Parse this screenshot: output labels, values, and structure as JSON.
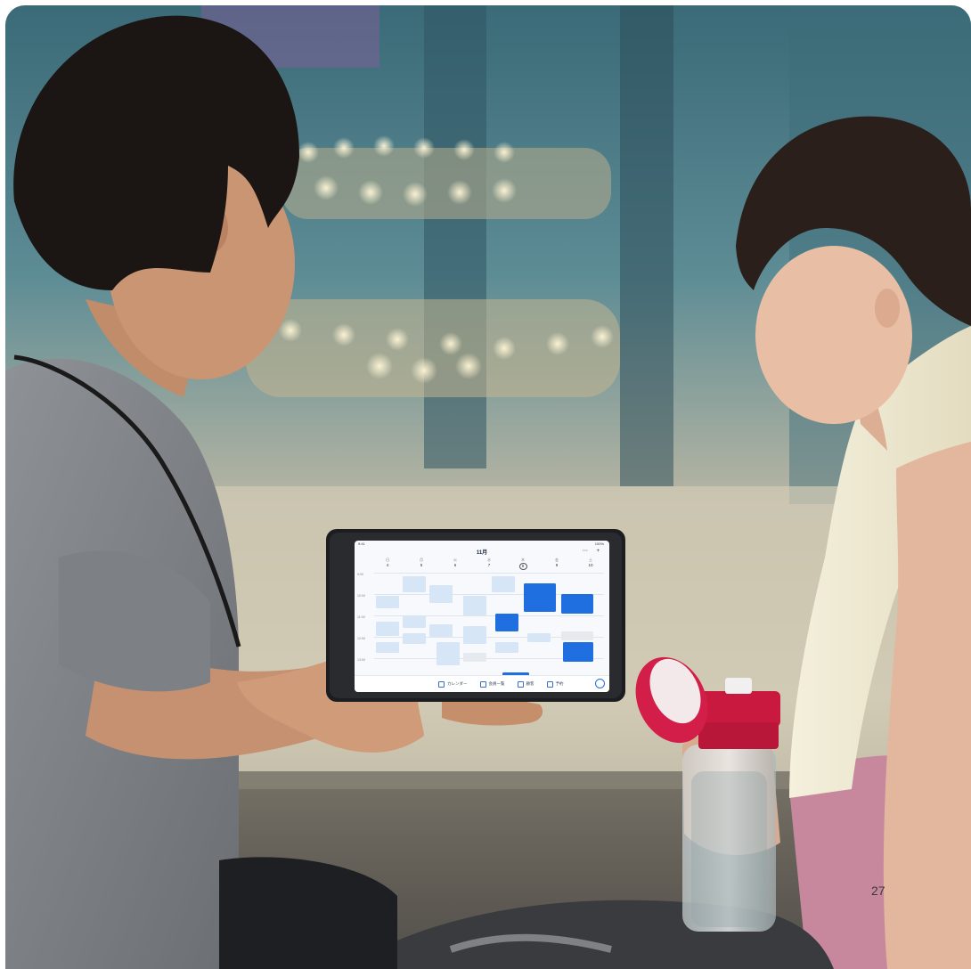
{
  "page": {
    "number": "27"
  },
  "tablet": {
    "month_title": "11月",
    "header_icons": "⋯ +",
    "status_left": "9:41",
    "status_right": "100%",
    "weekdays": [
      {
        "w": "日",
        "d": "4"
      },
      {
        "w": "月",
        "d": "5"
      },
      {
        "w": "火",
        "d": "6"
      },
      {
        "w": "水",
        "d": "7"
      },
      {
        "w": "木",
        "d": "8"
      },
      {
        "w": "金",
        "d": "9"
      },
      {
        "w": "土",
        "d": "10"
      }
    ],
    "times": [
      "9:00",
      "10:00",
      "11:00",
      "12:00",
      "13:00"
    ],
    "tabs": [
      {
        "label": "カレンダー",
        "icon": "calendar-icon"
      },
      {
        "label": "会員一覧",
        "icon": "list-icon"
      },
      {
        "label": "顧客",
        "icon": "people-icon"
      },
      {
        "label": "予約",
        "icon": "booking-icon"
      }
    ]
  },
  "colors": {
    "event_light": "#d6e6f7",
    "event_dark": "#1f6fe0",
    "event_grey": "#e6e9ee"
  }
}
